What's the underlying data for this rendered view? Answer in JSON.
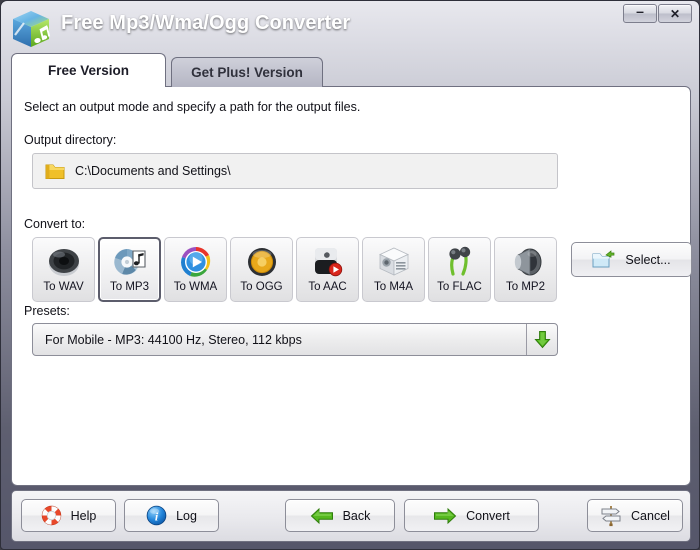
{
  "window": {
    "title": "Free Mp3/Wma/Ogg Converter",
    "app_icon": "music-cube-icon",
    "controls": [
      {
        "name": "minimize",
        "glyph": "–"
      },
      {
        "name": "close",
        "glyph": "✕"
      }
    ]
  },
  "tabs": [
    {
      "label": "Free Version",
      "active": true
    },
    {
      "label": "Get Plus! Version",
      "active": false
    }
  ],
  "main": {
    "intro": "Select an output mode and specify a path for the output files.",
    "output_directory": {
      "label": "Output directory:",
      "icon": "folder-icon",
      "path": "C:\\Documents and Settings\\",
      "select_button": {
        "label": "Select...",
        "icon": "folder-select-icon"
      }
    },
    "convert_to": {
      "label": "Convert to:",
      "selected": "To MP3",
      "options": [
        {
          "label": "To WAV",
          "icon": "speaker-dark-icon"
        },
        {
          "label": "To MP3",
          "icon": "cd-note-icon"
        },
        {
          "label": "To WMA",
          "icon": "color-wheel-play-icon"
        },
        {
          "label": "To OGG",
          "icon": "speaker-gold-icon"
        },
        {
          "label": "To AAC",
          "icon": "apple-play-icon"
        },
        {
          "label": "To M4A",
          "icon": "cube-box-icon"
        },
        {
          "label": "To FLAC",
          "icon": "earbuds-icon"
        },
        {
          "label": "To MP2",
          "icon": "speaker-cone-icon"
        }
      ]
    },
    "presets": {
      "label": "Presets:",
      "value": "For Mobile - MP3: 44100 Hz, Stereo, 112 kbps",
      "dropdown_icon": "green-down-arrow-icon"
    }
  },
  "footer": {
    "buttons": [
      {
        "label": "Help",
        "icon": "lifebuoy-icon"
      },
      {
        "label": "Log",
        "icon": "info-icon"
      },
      {
        "label": "Back",
        "icon": "green-left-arrow-icon"
      },
      {
        "label": "Convert",
        "icon": "green-right-arrow-icon"
      },
      {
        "label": "Cancel",
        "icon": "signpost-icon"
      }
    ]
  },
  "colors": {
    "title_bar_top": "#e8e8ee",
    "title_bar_bottom": "#55566a",
    "panel_bg": "#ffffff",
    "frame_border": "#6f7080",
    "accent_green": "#4aa820",
    "field_bg": "#f1f1f1"
  }
}
